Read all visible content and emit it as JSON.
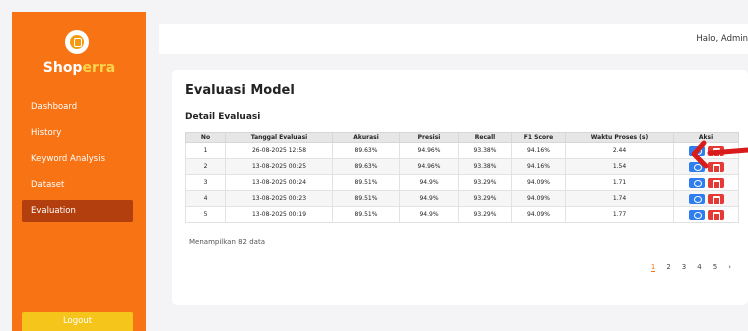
{
  "sidebar": {
    "brand_part1": "Shop",
    "brand_part2": "erra",
    "logo_icon": "shopping-bag-icon",
    "items": [
      {
        "label": "Dashboard"
      },
      {
        "label": "History"
      },
      {
        "label": "Keyword Analysis"
      },
      {
        "label": "Dataset"
      },
      {
        "label": "Evaluation"
      }
    ],
    "active": "Evaluation",
    "logout": "Logout"
  },
  "topbar": {
    "greeting": "Halo, Admin"
  },
  "page": {
    "title": "Evaluasi Model",
    "section": "Detail Evaluasi"
  },
  "table": {
    "headers": [
      "No",
      "Tanggal Evaluasi",
      "Akurasi",
      "Presisi",
      "Recall",
      "F1 Score",
      "Waktu Proses (s)",
      "Aksi"
    ],
    "rows": [
      [
        "1",
        "26-08-2025 12:58",
        "89.63%",
        "94.96%",
        "93.38%",
        "94.16%",
        "2.44"
      ],
      [
        "2",
        "13-08-2025 00:25",
        "89.63%",
        "94.96%",
        "93.38%",
        "94.16%",
        "1.54"
      ],
      [
        "3",
        "13-08-2025 00:24",
        "89.51%",
        "94.9%",
        "93.29%",
        "94.09%",
        "1.71"
      ],
      [
        "4",
        "13-08-2025 00:23",
        "89.51%",
        "94.9%",
        "93.29%",
        "94.09%",
        "1.74"
      ],
      [
        "5",
        "13-08-2025 00:19",
        "89.51%",
        "94.9%",
        "93.29%",
        "94.09%",
        "1.77"
      ]
    ],
    "action_icons": [
      "eye-icon",
      "trash-icon"
    ]
  },
  "footer": {
    "showing": "Menampilkan 82 data"
  },
  "pagination": {
    "pages": [
      "1",
      "2",
      "3",
      "4",
      "5"
    ],
    "active": "1",
    "next": "›"
  },
  "colors": {
    "sidebar": "#f77314",
    "sidebar_active": "#b23f0d",
    "brand_accent": "#fbd34d",
    "logout": "#f5c51b",
    "view_button": "#2f7ef0",
    "delete_button": "#e53935",
    "annotation_arrow": "#d81b1b"
  }
}
